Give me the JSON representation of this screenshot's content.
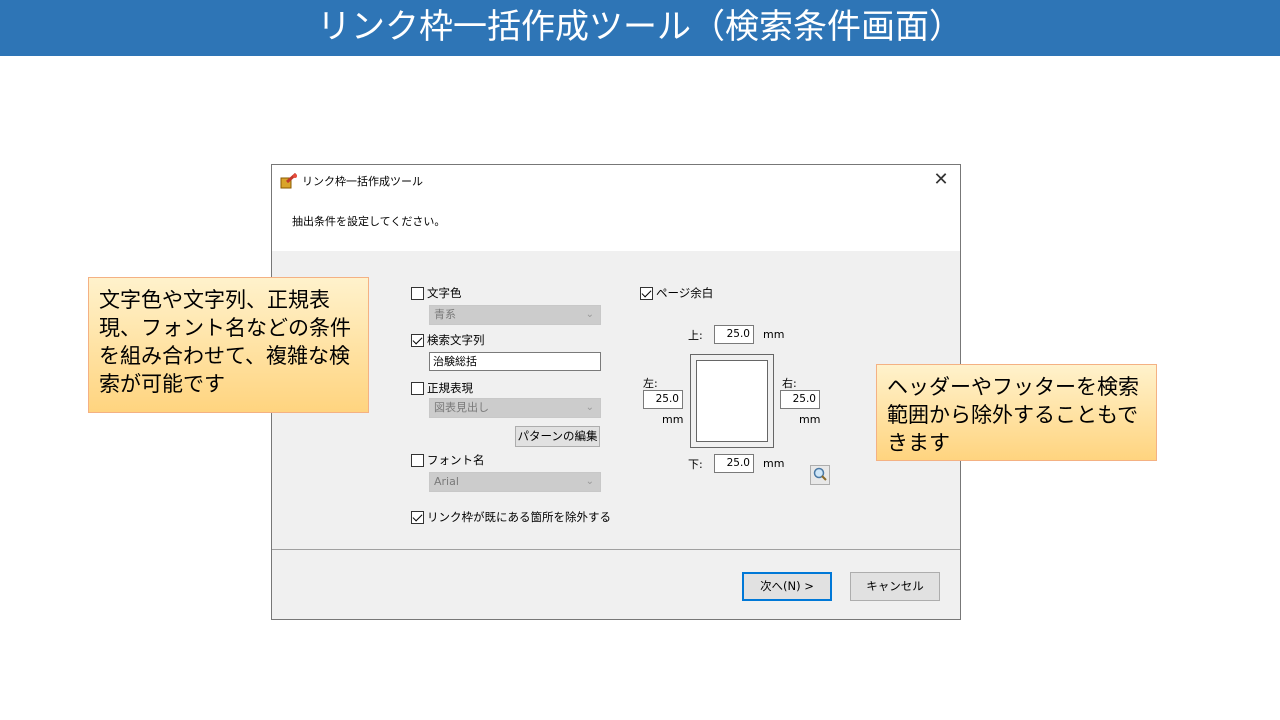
{
  "slide": {
    "title": "リンク枠一括作成ツール（検索条件画面）",
    "title_bg": "#2e75b6"
  },
  "dialog": {
    "title": "リンク枠一括作成ツール",
    "instruction": "抽出条件を設定してください。",
    "close_icon": "close-icon",
    "font_color_label": "文字色",
    "font_color_value": "青系",
    "search_string_label": "検索文字列",
    "search_string_value": "治験総括",
    "regex_label": "正規表現",
    "regex_value": "図表見出し",
    "edit_pattern_button": "パターンの編集",
    "font_name_label": "フォント名",
    "font_name_value": "Arial",
    "exclude_existing_label": "リンク枠が既にある箇所を除外する",
    "page_margin_label": "ページ余白",
    "margin_top_label": "上:",
    "margin_top_value": "25.0",
    "margin_left_label": "左:",
    "margin_left_value": "25.0",
    "margin_right_label": "右:",
    "margin_right_value": "25.0",
    "margin_bottom_label": "下:",
    "margin_bottom_value": "25.0",
    "unit": "mm",
    "next_button": "次へ(N) >",
    "cancel_button": "キャンセル",
    "checked": {
      "font_color": false,
      "search_string": true,
      "regex": false,
      "font_name": false,
      "exclude_existing": true,
      "page_margin": true
    }
  },
  "callouts": {
    "left": "文字色や文字列、正規表現、フォント名などの条件を組み合わせて、複雑な検索が可能です",
    "right": "ヘッダーやフッターを検索範囲から除外することもできます"
  }
}
